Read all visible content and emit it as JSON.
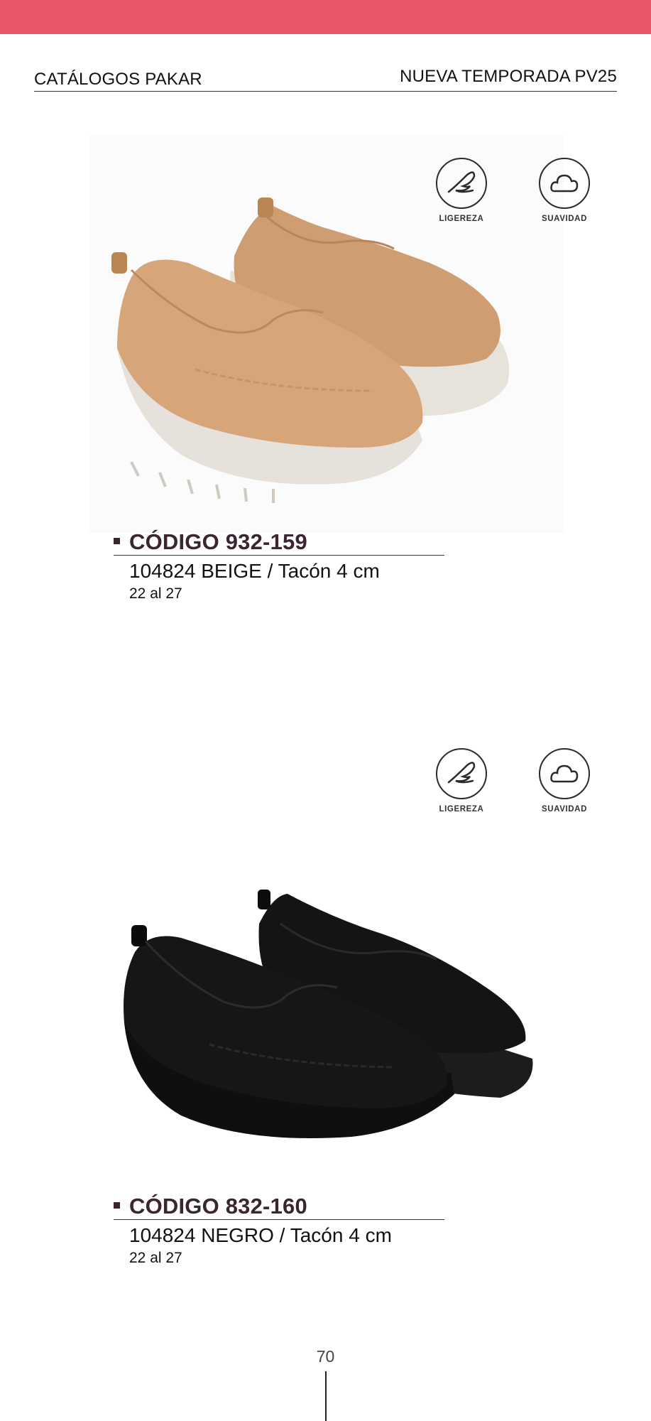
{
  "header": {
    "left": "CATÁLOGOS PAKAR",
    "right": "NUEVA TEMPORADA PV25"
  },
  "colors": {
    "top_bar": "#e9566b",
    "code_text": "#3a2530",
    "beige_shoe": "#d6a57a",
    "black_shoe": "#141414",
    "sole_beige": "#e6e1da"
  },
  "products": [
    {
      "code": "CÓDIGO 932-159",
      "description": "104824 BEIGE / Tacón 4 cm",
      "sizes": "22 al 27",
      "features": [
        {
          "label": "LIGEREZA",
          "icon": "feather-icon"
        },
        {
          "label": "SUAVIDAD",
          "icon": "cloud-icon"
        }
      ],
      "image": "beige-knit-wedge-loafers"
    },
    {
      "code": "CÓDIGO 832-160",
      "description": "104824 NEGRO / Tacón 4 cm",
      "sizes": "22 al 27",
      "features": [
        {
          "label": "LIGEREZA",
          "icon": "feather-icon"
        },
        {
          "label": "SUAVIDAD",
          "icon": "cloud-icon"
        }
      ],
      "image": "black-knit-wedge-loafers"
    }
  ],
  "page_number": "70"
}
